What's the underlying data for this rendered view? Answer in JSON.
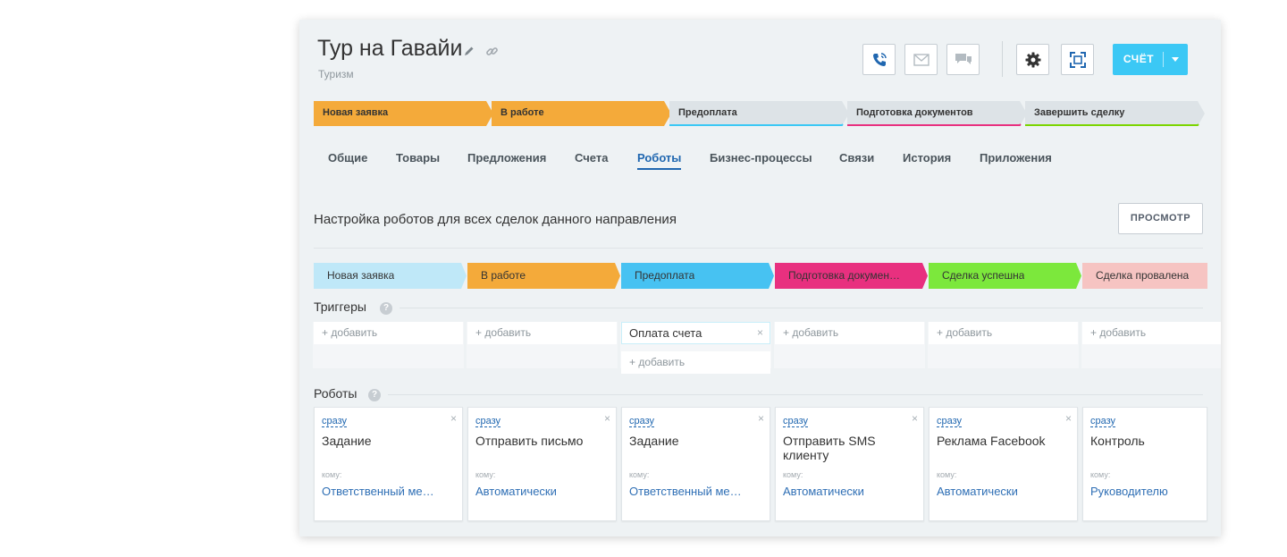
{
  "deal": {
    "title": "Тур на Гавайи",
    "category": "Туризм"
  },
  "toolbar": {
    "icons": [
      "phone-icon",
      "mail-icon",
      "chat-icon",
      "gear-icon",
      "scan-icon"
    ],
    "account_label": "СЧЁТ"
  },
  "pipeline": [
    {
      "label": "Новая заявка",
      "color": "#f4aa3a",
      "active": true
    },
    {
      "label": "В работе",
      "color": "#f4aa3a",
      "active": true
    },
    {
      "label": "Предоплата",
      "color": "#3bc8f5",
      "active": false
    },
    {
      "label": "Подготовка документов",
      "color": "#e8307f",
      "active": false
    },
    {
      "label": "Завершить сделку",
      "color": "#7bd500",
      "active": false
    }
  ],
  "tabs": [
    {
      "label": "Общие",
      "active": false
    },
    {
      "label": "Товары",
      "active": false
    },
    {
      "label": "Предложения",
      "active": false
    },
    {
      "label": "Счета",
      "active": false
    },
    {
      "label": "Роботы",
      "active": true
    },
    {
      "label": "Бизнес-процессы",
      "active": false
    },
    {
      "label": "Связи",
      "active": false
    },
    {
      "label": "История",
      "active": false
    },
    {
      "label": "Приложения",
      "active": false
    }
  ],
  "robots_section": {
    "title": "Настройка роботов для всех сделок данного направления",
    "preview_label": "ПРОСМОТР",
    "stages": [
      {
        "label": "Новая заявка",
        "color": "#bfe8f8"
      },
      {
        "label": "В работе",
        "color": "#f4aa3a"
      },
      {
        "label": "Предоплата",
        "color": "#47c2f2"
      },
      {
        "label": "Подготовка докумен…",
        "color": "#e8307f"
      },
      {
        "label": "Сделка успешна",
        "color": "#7ce83c"
      },
      {
        "label": "Сделка провалена",
        "color": "#f6c4c2"
      }
    ],
    "triggers_label": "Триггеры",
    "robots_label": "Роботы",
    "help_glyph": "?",
    "add_label": "+ добавить",
    "close_glyph": "×",
    "trigger_items": [
      {
        "stage": 2,
        "label": "Оплата счета"
      }
    ],
    "robots": [
      {
        "when": "сразу",
        "name": "Задание",
        "to_label": "кому:",
        "to": "Ответственный ме…"
      },
      {
        "when": "сразу",
        "name": "Отправить письмо",
        "to_label": "кому:",
        "to": "Автоматически"
      },
      {
        "when": "сразу",
        "name": "Задание",
        "to_label": "кому:",
        "to": "Ответственный ме…"
      },
      {
        "when": "сразу",
        "name": "Отправить SMS клиенту",
        "to_label": "кому:",
        "to": "Автоматически"
      },
      {
        "when": "сразу",
        "name": "Реклама Facebook",
        "to_label": "кому:",
        "to": "Автоматически"
      },
      {
        "when": "сразу",
        "name": "Контроль",
        "to_label": "кому:",
        "to": "Руководителю"
      }
    ]
  }
}
